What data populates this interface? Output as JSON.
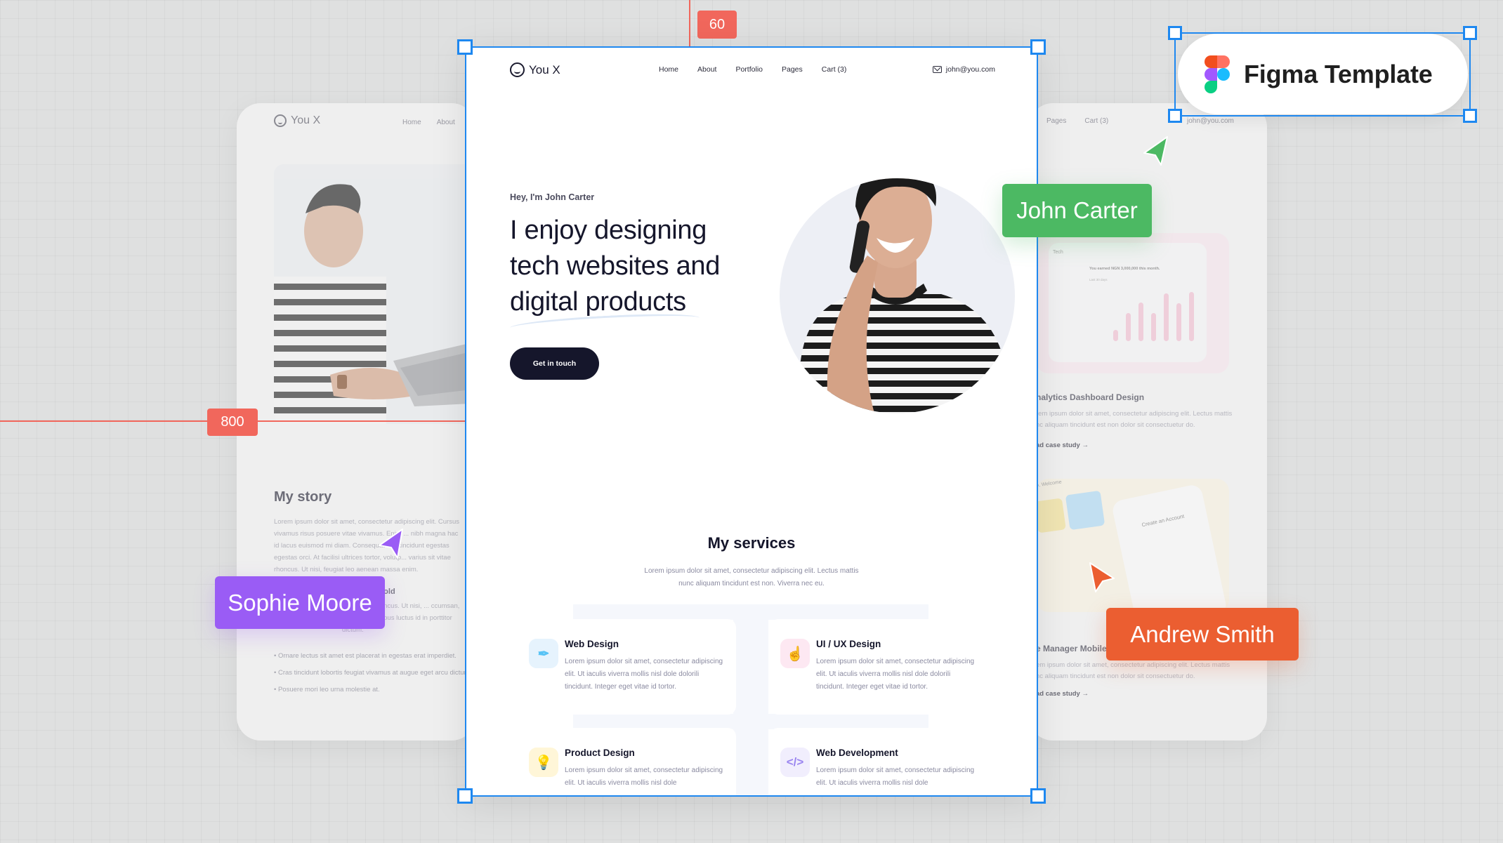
{
  "canvas": {
    "measure_top": "60",
    "measure_left": "800",
    "figma_badge": {
      "label": "Figma Template",
      "icon": "figma-logo-icon"
    }
  },
  "cursors": [
    {
      "name": "John Carter",
      "color": "#4cb963"
    },
    {
      "name": "Sophie Moore",
      "color": "#9a5cf5"
    },
    {
      "name": "Andrew Smith",
      "color": "#eb5e31"
    }
  ],
  "main": {
    "nav": {
      "brand": "You X",
      "links": [
        "Home",
        "About",
        "Portfolio",
        "Pages",
        "Cart (3)"
      ],
      "email": "john@you.com"
    },
    "hero": {
      "eyebrow": "Hey, I'm John Carter",
      "title": "I enjoy designing tech websites and digital products",
      "cta": "Get in touch"
    },
    "services": {
      "title": "My services",
      "subtitle": "Lorem ipsum dolor sit amet, consectetur adipiscing elit. Lectus mattis nunc aliquam tincidunt est non. Viverra nec eu.",
      "items": [
        {
          "title": "Web Design",
          "text": "Lorem ipsum dolor sit amet, consectetur adipiscing elit. Ut iaculis viverra mollis nisl dole dolorili tincidunt. Integer eget vitae id tortor.",
          "icon": "pen-tool-icon",
          "icon_bg": "#e6f3fd",
          "icon_color": "#58c3f5"
        },
        {
          "title": "UI / UX Design",
          "text": "Lorem ipsum dolor sit amet, consectetur adipiscing elit. Ut iaculis viverra mollis nisl dole dolorili tincidunt. Integer eget vitae id tortor.",
          "icon": "touch-icon",
          "icon_bg": "#fde8f2",
          "icon_color": "#f7a8cf"
        },
        {
          "title": "Product Design",
          "text": "Lorem ipsum dolor sit amet, consectetur adipiscing elit. Ut iaculis viverra mollis nisl dole",
          "icon": "lightbulb-icon",
          "icon_bg": "#fff6d8",
          "icon_color": "#f8d34a"
        },
        {
          "title": "Web Development",
          "text": "Lorem ipsum dolor sit amet, consectetur adipiscing elit. Ut iaculis viverra mollis nisl dole",
          "icon": "code-icon",
          "icon_bg": "#f1eefd",
          "icon_color": "#9b86f0"
        }
      ]
    }
  },
  "left_card": {
    "brand": "You X",
    "links": [
      "Home",
      "About"
    ],
    "story_title": "My story",
    "story_text": "Lorem ipsum dolor sit amet, consectetur adipiscing elit. Cursus vivamus risus posuere vitae vivamus. Enim ... nibh magna hac id lacus euismod mi diam. Consequat el... tincidunt egestas egestas orci. At facilisi ultrices tortor, volutp... varius sit vitae rhoncus. Ut nisi, feugiat leo aenean massa enim.",
    "sub_heading": "s old",
    "sub_text": "... sit vitae rhoncus. Ut nisi, ... ccumsan, ac dictum tempus luctus id in porttitor dictum.",
    "bullets": [
      "Ornare lectus sit amet est placerat in egestas erat imperdiet.",
      "Cras tincidunt lobortis feugiat vivamus at augue eget arcu dictum.",
      "Posuere mori leo urna molestie at."
    ]
  },
  "right_card": {
    "links": [
      "Pages",
      "Cart (3)"
    ],
    "email": "john@you.com",
    "dashboard": {
      "brand": "Tech",
      "headline": "You earned NGN 3,000,000 this month.",
      "period": "Last 30 days"
    },
    "projects": [
      {
        "title": "nalytics Dashboard Design",
        "text": "rem ipsum dolor sit amet, consectetur adipiscing elit. Lectus mattis nc aliquam tincidunt est non dolor sit consectuetur do.",
        "link": "ad case study"
      },
      {
        "title": "e Manager Mobile",
        "text": "em ipsum dolor sit amet, consectetur adipiscing elit. Lectus mattis nc aliquam tincidunt est non dolor sit consectuetur do.",
        "link": "ad case study"
      }
    ],
    "mobile": {
      "welcome": "o, Welcome",
      "screen_title": "Create an Account"
    }
  }
}
